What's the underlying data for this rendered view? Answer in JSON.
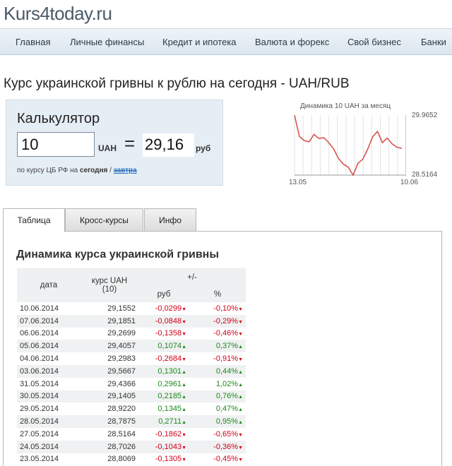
{
  "site": {
    "logo": "Kurs4today.ru"
  },
  "nav": {
    "items": [
      "Главная",
      "Личные финансы",
      "Кредит и ипотека",
      "Валюта и форекс",
      "Свой бизнес",
      "Банки"
    ]
  },
  "page": {
    "title": "Курс украинской гривны к рублю на сегодня - UAH/RUB"
  },
  "calculator": {
    "title": "Калькулятор",
    "input_value": "10",
    "from_currency": "UAH",
    "equals": "=",
    "result": "29,16",
    "to_currency": "руб",
    "note_prefix": "по курсу ЦБ РФ на",
    "note_today": "сегодня",
    "note_sep": "/",
    "note_tomorrow": "завтра"
  },
  "sparkline": {
    "title": "Динамика 10 UAH за месяц",
    "max_label": "29.9652",
    "min_label": "28.5164",
    "start_label": "13.05",
    "end_label": "10.06",
    "values": [
      29.9652,
      29.45,
      29.35,
      29.32,
      29.5,
      29.4,
      29.42,
      29.3,
      29.15,
      28.92,
      28.78,
      28.71,
      28.5164,
      28.8,
      28.9,
      29.14,
      29.44,
      29.57,
      29.3,
      29.41,
      29.27,
      29.19,
      29.16
    ],
    "line_color": "#d9534f"
  },
  "tabs": [
    {
      "label": "Таблица",
      "active": true
    },
    {
      "label": "Кросс-курсы",
      "active": false
    },
    {
      "label": "Инфо",
      "active": false
    }
  ],
  "dynamics": {
    "title": "Динамика курса украинской гривны",
    "headers": {
      "date": "дата",
      "rate": "курс UAH",
      "rate_sub": "(10)",
      "change": "+/-",
      "rub": "руб",
      "pct": "%"
    },
    "rows": [
      {
        "date": "10.06.2014",
        "rate": "29,1552",
        "rub": "-0,0299",
        "pct": "-0,10%",
        "dir": "down"
      },
      {
        "date": "07.06.2014",
        "rate": "29,1851",
        "rub": "-0,0848",
        "pct": "-0,29%",
        "dir": "down"
      },
      {
        "date": "06.06.2014",
        "rate": "29,2699",
        "rub": "-0,1358",
        "pct": "-0,46%",
        "dir": "down"
      },
      {
        "date": "05.06.2014",
        "rate": "29,4057",
        "rub": "0,1074",
        "pct": "0,37%",
        "dir": "up"
      },
      {
        "date": "04.06.2014",
        "rate": "29,2983",
        "rub": "-0,2684",
        "pct": "-0,91%",
        "dir": "down"
      },
      {
        "date": "03.06.2014",
        "rate": "29,5667",
        "rub": "0,1301",
        "pct": "0,44%",
        "dir": "up"
      },
      {
        "date": "31.05.2014",
        "rate": "29,4366",
        "rub": "0,2961",
        "pct": "1,02%",
        "dir": "up"
      },
      {
        "date": "30.05.2014",
        "rate": "29,1405",
        "rub": "0,2185",
        "pct": "0,76%",
        "dir": "up"
      },
      {
        "date": "29.05.2014",
        "rate": "28,9220",
        "rub": "0,1345",
        "pct": "0,47%",
        "dir": "up"
      },
      {
        "date": "28.05.2014",
        "rate": "28,7875",
        "rub": "0,2711",
        "pct": "0,95%",
        "dir": "up"
      },
      {
        "date": "27.05.2014",
        "rate": "28,5164",
        "rub": "-0,1862",
        "pct": "-0,65%",
        "dir": "down"
      },
      {
        "date": "24.05.2014",
        "rate": "28,7026",
        "rub": "-0,1043",
        "pct": "-0,36%",
        "dir": "down"
      },
      {
        "date": "23.05.2014",
        "rate": "28,8069",
        "rub": "-0,1305",
        "pct": "-0,45%",
        "dir": "down"
      }
    ]
  }
}
